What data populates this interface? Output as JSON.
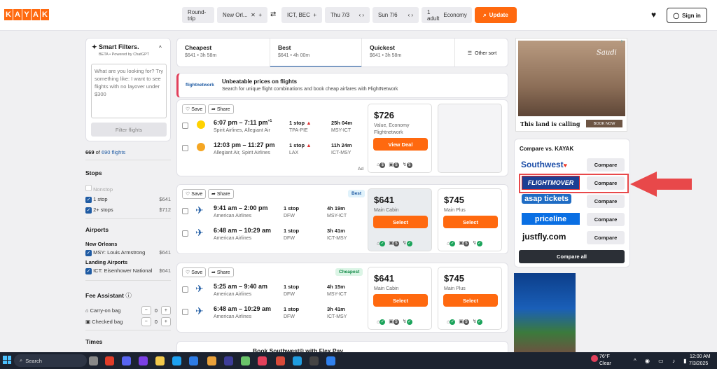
{
  "header": {
    "trip_type": "Round-trip",
    "origin": "New Orl...",
    "destination": "ICT, BEC",
    "depart": "Thu 7/3",
    "return": "Sun 7/6",
    "travelers": "1 adult",
    "cabin": "Economy",
    "update": "Update",
    "signin": "Sign in",
    "logo": [
      "K",
      "A",
      "Y",
      "A",
      "K"
    ]
  },
  "smart": {
    "title": "Smart Filters.",
    "beta": "BETA • Powered by ChatGPT",
    "placeholder": "What are you looking for? Try something like: I want to see flights with no layover under $300",
    "button": "Filter flights",
    "count_a": "669",
    "count_of": "of",
    "count_b": "690 flights"
  },
  "stops": {
    "title": "Stops",
    "items": [
      {
        "label": "Nonstop",
        "price": ""
      },
      {
        "label": "1 stop",
        "price": "$641"
      },
      {
        "label": "2+ stops",
        "price": "$712"
      }
    ]
  },
  "airports": {
    "title": "Airports",
    "sub1": "New Orleans",
    "a1": "MSY: Louis Armstrong",
    "p1": "$641",
    "sub2": "Landing Airports",
    "a2": "ICT: Eisenhower National",
    "p2": "$641"
  },
  "fees": {
    "title": "Fee Assistant",
    "carry": "Carry-on bag",
    "checked": "Checked bag",
    "carry_v": "0",
    "checked_v": "0"
  },
  "times": {
    "title": "Times"
  },
  "sort": {
    "cheapest": "Cheapest",
    "cheapest_sub": "$641 • 3h 58m",
    "best": "Best",
    "best_sub": "$641 • 4h 00m",
    "quickest": "Quickest",
    "quickest_sub": "$641 • 3h 58m",
    "other": "Other sort"
  },
  "banner": {
    "logo": "flightnetwork",
    "title": "Unbeatable prices on flights",
    "sub": "Search for unique flight combinations and book cheap airfares with FlightNetwork"
  },
  "common": {
    "save": "Save",
    "share": "Share",
    "select": "Select",
    "ad": "Ad",
    "compare": "Compare"
  },
  "r1": {
    "l1": {
      "time": "6:07 pm – 7:11 pm",
      "sup": "+1",
      "air": "Spirit Airlines, Allegiant Air",
      "stops": "1 stop",
      "via": "TPA-PIE",
      "dur": "25h 04m",
      "route": "MSY-ICT"
    },
    "l2": {
      "time": "12:03 pm – 11:27 pm",
      "air": "Allegiant Air, Spirit Airlines",
      "stops": "1 stop",
      "via": "LAX",
      "dur": "11h 24m",
      "route": "ICT-MSY"
    },
    "price": "$726",
    "cabin": "Value, Economy",
    "provider": "Flightnetwork",
    "btn": "View Deal"
  },
  "r2": {
    "badge": "Best",
    "l1": {
      "time": "9:41 am – 2:00 pm",
      "air": "American Airlines",
      "stops": "1 stop",
      "via": "DFW",
      "dur": "4h 19m",
      "route": "MSY-ICT"
    },
    "l2": {
      "time": "6:48 am – 10:29 am",
      "air": "American Airlines",
      "stops": "1 stop",
      "via": "DFW",
      "dur": "3h 41m",
      "route": "ICT-MSY"
    },
    "p1": "$641",
    "c1": "Main Cabin",
    "p2": "$745",
    "c2": "Main Plus"
  },
  "r3": {
    "badge": "Cheapest",
    "l1": {
      "time": "5:25 am – 9:40 am",
      "air": "American Airlines",
      "stops": "1 stop",
      "via": "DFW",
      "dur": "4h 15m",
      "route": "MSY-ICT"
    },
    "l2": {
      "time": "6:48 am – 10:29 am",
      "air": "American Airlines",
      "stops": "1 stop",
      "via": "DFW",
      "dur": "3h 41m",
      "route": "ICT-MSY"
    },
    "p1": "$641",
    "c1": "Main Cabin",
    "p2": "$745",
    "c2": "Main Plus"
  },
  "r4": {
    "title": "Book Southwest® with Flex Pay"
  },
  "ad1": {
    "brand": "Saudi",
    "tag": "This land is calling",
    "cta": "BOOK NOW"
  },
  "compare": {
    "title": "Compare vs. KAYAK",
    "vendors": [
      "Southwest",
      "FLIGHTMOVER",
      "asap tickets",
      "priceline",
      "justfly.com"
    ],
    "all": "Compare all"
  },
  "taskbar": {
    "search": "Search",
    "temp": "76°F",
    "weather": "Clear",
    "time": "12:00 AM",
    "date": "7/3/2025"
  }
}
